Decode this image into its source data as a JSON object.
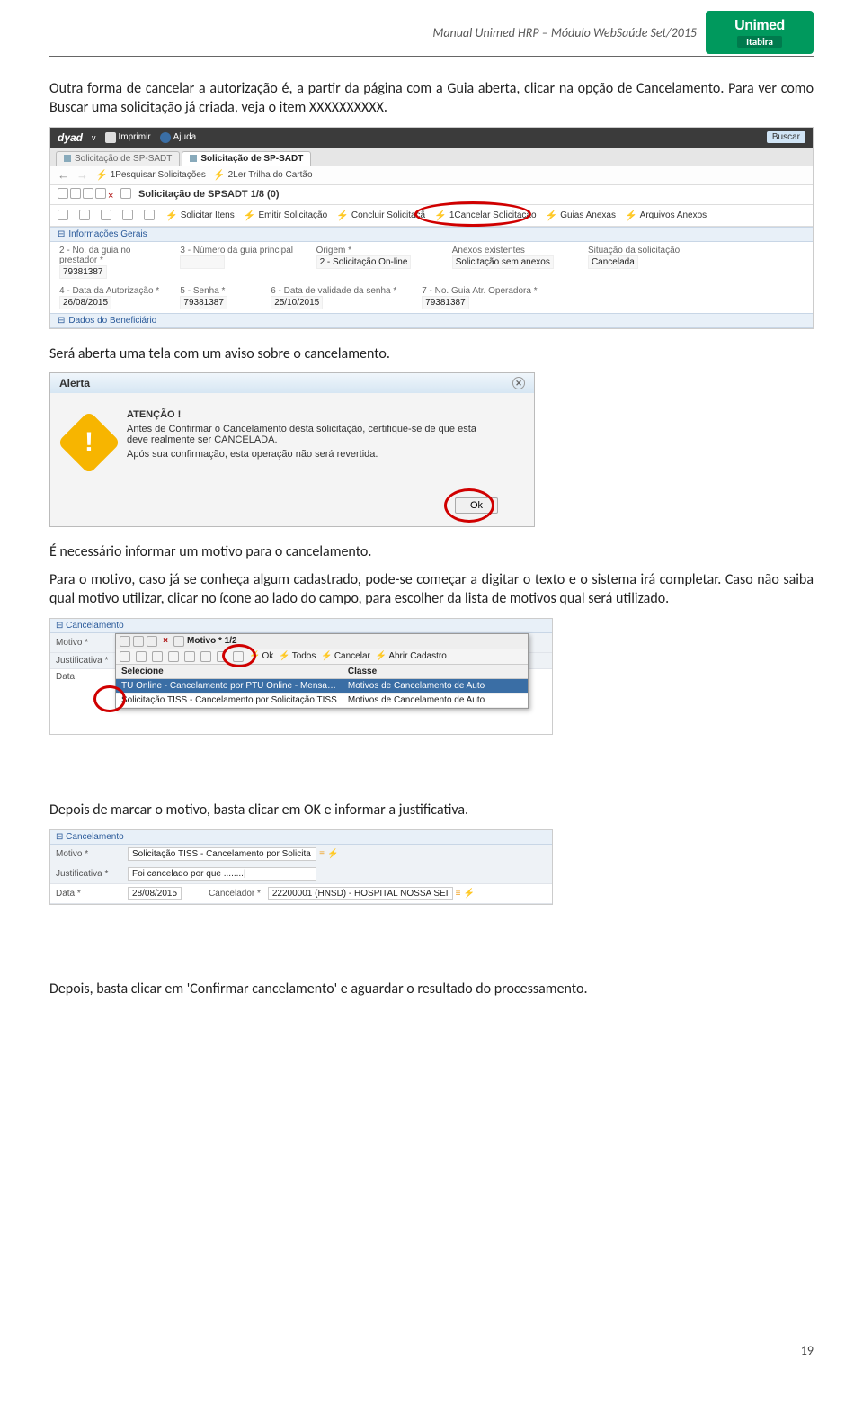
{
  "header": {
    "doc_title": "Manual Unimed HRP – Módulo WebSaúde   Set/2015",
    "logo_brand": "Unimed",
    "logo_sub": "Itabira"
  },
  "para1": "Outra forma de cancelar a autorização é, a partir da página com a Guia aberta, clicar na opção de Cancelamento. Para ver como Buscar uma solicitação já criada, veja o item XXXXXXXXXX.",
  "ss1": {
    "top": {
      "brand": "dyad",
      "ver": "v",
      "print": "Imprimir",
      "help": "Ajuda",
      "search": "Buscar"
    },
    "tabs": {
      "tab1": "Solicitação de SP-SADT",
      "tab2": "Solicitação de SP-SADT"
    },
    "nav": {
      "link1": "1Pesquisar Solicitações",
      "link2": "2Ler Trilha do Cartão"
    },
    "rec": {
      "title": "Solicitação de SPSADT  1/8 (0)"
    },
    "actions": {
      "a1": "Solicitar Itens",
      "a2": "Emitir Solicitação",
      "a3": "Concluir Solicitaçã",
      "a4": "1Cancelar Solicitação",
      "a5": "Guias Anexas",
      "a6": "Arquivos Anexos"
    },
    "sec_info": "Informações Gerais",
    "fields": {
      "f2_lbl": "2 - No. da guia no prestador *",
      "f2_val": "79381387",
      "f3_lbl": "3 - Número da guia principal",
      "f_origem_lbl": "Origem *",
      "f_origem_val": "2 - Solicitação On-line",
      "f_anex_lbl": "Anexos existentes",
      "f_anex_val": "Solicitação sem anexos",
      "f_sit_lbl": "Situação da solicitação",
      "f_sit_val": "Cancelada",
      "f4_lbl": "4 - Data da Autorização *",
      "f4_val": "26/08/2015",
      "f5_lbl": "5 - Senha *",
      "f5_val": "79381387",
      "f6_lbl": "6 - Data de validade da senha *",
      "f6_val": "25/10/2015",
      "f7_lbl": "7 - No. Guia Atr. Operadora *",
      "f7_val": "79381387"
    },
    "sec_benef": "Dados do Beneficiário"
  },
  "para2": "Será aberta uma tela com um aviso sobre o cancelamento.",
  "alert": {
    "title": "Alerta",
    "attn": "ATENÇÃO !",
    "line1": "Antes de Confirmar o Cancelamento desta solicitação, certifique-se de que esta deve realmente ser CANCELADA.",
    "line2": "Após sua confirmação, esta operação não será revertida.",
    "ok": "Ok"
  },
  "para3": "É necessário informar um motivo para o cancelamento.",
  "para4": "Para o motivo, caso já se conheça algum cadastrado, pode-se começar a digitar o texto e o sistema irá completar. Caso não saiba qual motivo utilizar, clicar no ícone ao lado do campo, para escolher da lista de motivos qual será utilizado.",
  "ss3": {
    "sec": "Cancelamento",
    "motivo_lbl": "Motivo *",
    "justif_lbl": "Justificativa *",
    "data_lbl": "Data",
    "popup_title": "Motivo *  1/2",
    "p_ok": "Ok",
    "p_todos": "Todos",
    "p_cancel": "Cancelar",
    "p_abrir": "Abrir Cadastro",
    "col1": "Selecione",
    "col2": "Classe",
    "row1a": "TU Online - Cancelamento por PTU Online - Mensage",
    "row1b": "Motivos de Cancelamento de Auto",
    "row2a": "Solicitação TISS - Cancelamento por Solicitação TISS",
    "row2b": "Motivos de Cancelamento de Auto"
  },
  "para5": "Depois de marcar o motivo, basta clicar em OK e informar a justificativa.",
  "ss4": {
    "sec": "Cancelamento",
    "motivo_lbl": "Motivo *",
    "motivo_val": "Solicitação TISS - Cancelamento por Solicita",
    "justif_lbl": "Justificativa *",
    "justif_val": "Foi cancelado por que ........|",
    "data_lbl": "Data *",
    "data_val": "28/08/2015",
    "canc_lbl": "Cancelador *",
    "canc_val": "22200001 (HNSD) - HOSPITAL NOSSA SEI"
  },
  "para6": "Depois, basta clicar em 'Confirmar cancelamento' e aguardar o resultado do processamento.",
  "page_number": "19"
}
